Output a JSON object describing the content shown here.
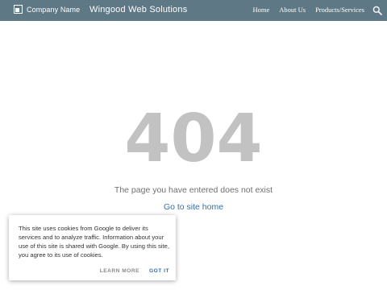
{
  "header": {
    "logo_text": "Company Name",
    "site_title": "Wingood Web Solutions",
    "nav_items": [
      "Home",
      "About Us",
      "Products/Services"
    ],
    "search_icon": "search-icon",
    "background_color": "#5f7886"
  },
  "main": {
    "error_code": "404",
    "message": "The page you have entered does not exist",
    "home_link": "Go to site home",
    "link_color": "#3670a8"
  },
  "cookie_banner": {
    "text": "This site uses cookies from Google to deliver its services and to analyze traffic. Information about your use of this site is shared with Google. By using this site, you agree to its use of cookies.",
    "learn_more_label": "LEARN MORE",
    "got_it_label": "GOT IT"
  }
}
